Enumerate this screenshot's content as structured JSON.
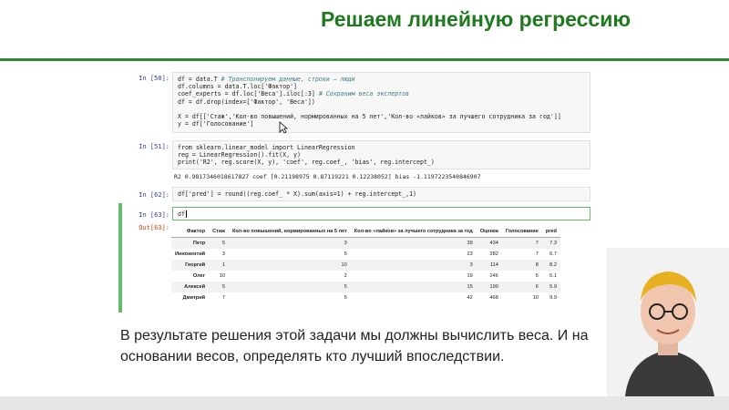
{
  "slide": {
    "title": "Решаем линейную регрессию",
    "caption": "В результате решения этой задачи мы должны вычислить веса. И на основании весов, определять кто лучший впоследствии."
  },
  "notebook": {
    "cells": [
      {
        "prompt": "In [50]:",
        "lines": [
          {
            "code": "df = data.T ",
            "comment": "# Транспонируем данные, строки — люди"
          },
          {
            "code": "df.columns = data.T.loc['Фактор']"
          },
          {
            "code": "coef_experts = df.loc['Веса'].iloc[:3] ",
            "comment": "# Сохраним веса экспертов"
          },
          {
            "code": "df = df.drop(index=['Фактор', 'Веса'])"
          },
          {
            "code": ""
          },
          {
            "code": "X = df[['Стаж','Кол-во повышений, нормированных на 5 лет','Кол-во «лайков» за лучшего сотрудника за год']]"
          },
          {
            "code": "y = df['Голосование']"
          }
        ]
      },
      {
        "prompt": "In [51]:",
        "lines": [
          {
            "code": "from sklearn.linear_model import LinearRegression"
          },
          {
            "code": "reg = LinearRegression().fit(X, y)"
          },
          {
            "code": "print('R2', reg.score(X, y), 'coef', reg.coef_, 'bias', reg.intercept_)"
          }
        ],
        "output": "R2 0.9817346018617827 coef [0.21198975 0.87119221 0.12238052] bias -1.1197223540846907"
      },
      {
        "prompt": "In [62]:",
        "lines": [
          {
            "code": "df['pred'] = round((reg.coef_ * X).sum(axis=1) + reg.intercept_,1)"
          }
        ]
      },
      {
        "prompt": "In [63]:",
        "lines": [
          {
            "code": "df"
          }
        ],
        "out_prompt": "Out[63]:"
      }
    ],
    "table": {
      "index_header": "Фактор",
      "columns": [
        "Стаж",
        "Кол-во повышений, нормированных на 5 лет",
        "Кол-во «лайков» за лучшего сотрудника за год",
        "Оценка",
        "Голосование",
        "pred"
      ],
      "rows": [
        {
          "name": "Петр",
          "values": [
            "5",
            "3",
            "39",
            "434",
            "7",
            "7.3"
          ]
        },
        {
          "name": "Иннокентий",
          "values": [
            "3",
            "5",
            "23",
            "282",
            "7",
            "6.7"
          ]
        },
        {
          "name": "Георгий",
          "values": [
            "1",
            "10",
            "3",
            "114",
            "8",
            "8.2"
          ]
        },
        {
          "name": "Олег",
          "values": [
            "10",
            "2",
            "19",
            "246",
            "5",
            "5.1"
          ]
        },
        {
          "name": "Алексей",
          "values": [
            "5",
            "5",
            "15",
            "190",
            "6",
            "5.9"
          ]
        },
        {
          "name": "Дмитрий",
          "values": [
            "7",
            "5",
            "42",
            "468",
            "10",
            "9.9"
          ]
        }
      ]
    }
  },
  "colors": {
    "title_green": "#1f7a1f",
    "rule_green": "#2e8b2e",
    "in_prompt": "#303f9f",
    "out_prompt": "#d84315",
    "active_cell_border": "#66bb6a"
  }
}
